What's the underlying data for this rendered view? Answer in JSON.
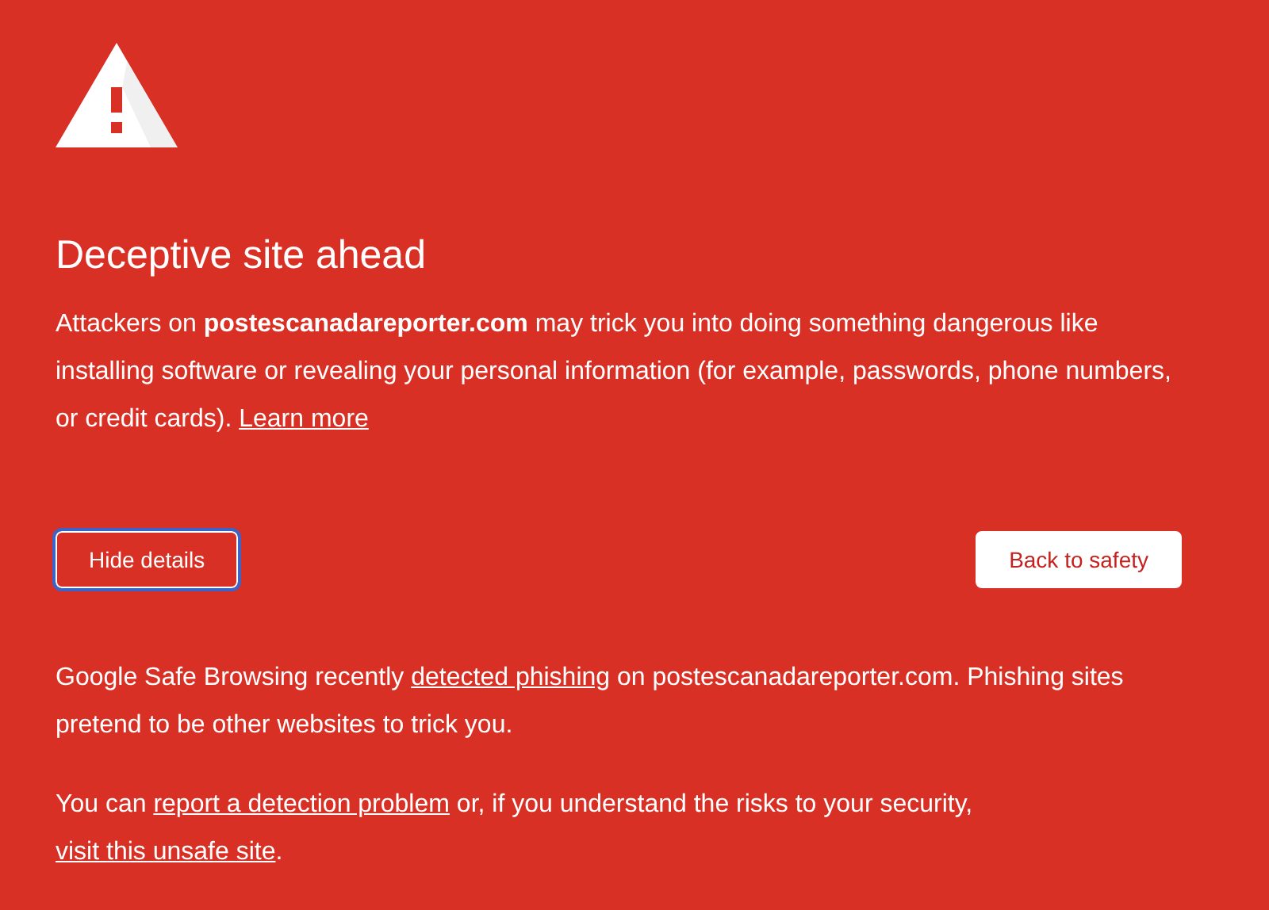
{
  "heading": "Deceptive site ahead",
  "main_message": [
    {
      "kind": "text",
      "text": "Attackers on "
    },
    {
      "kind": "bold",
      "text": "postescanadareporter.com"
    },
    {
      "kind": "text",
      "text": " may trick you into doing something dangerous like installing software or revealing your personal information (for example, passwords, phone numbers, or credit cards). "
    },
    {
      "kind": "link",
      "text": "Learn more"
    }
  ],
  "buttons": [
    {
      "label": "Hide details",
      "kind": "secondary",
      "focused": true
    },
    {
      "label": "Back to safety",
      "kind": "primary",
      "focused": false
    }
  ],
  "details": [
    [
      {
        "kind": "text",
        "text": "Google Safe Browsing recently "
      },
      {
        "kind": "link",
        "text": "detected phishing"
      },
      {
        "kind": "text",
        "text": " on postescanadareporter.com. Phishing sites pretend to be other websites to trick you."
      }
    ],
    [
      {
        "kind": "text",
        "text": "You can "
      },
      {
        "kind": "link",
        "text": "report a detection problem"
      },
      {
        "kind": "text",
        "text": " or, if you understand the risks to your security, "
      },
      {
        "kind": "link",
        "text": "visit this unsafe site"
      },
      {
        "kind": "text",
        "text": "."
      }
    ]
  ]
}
